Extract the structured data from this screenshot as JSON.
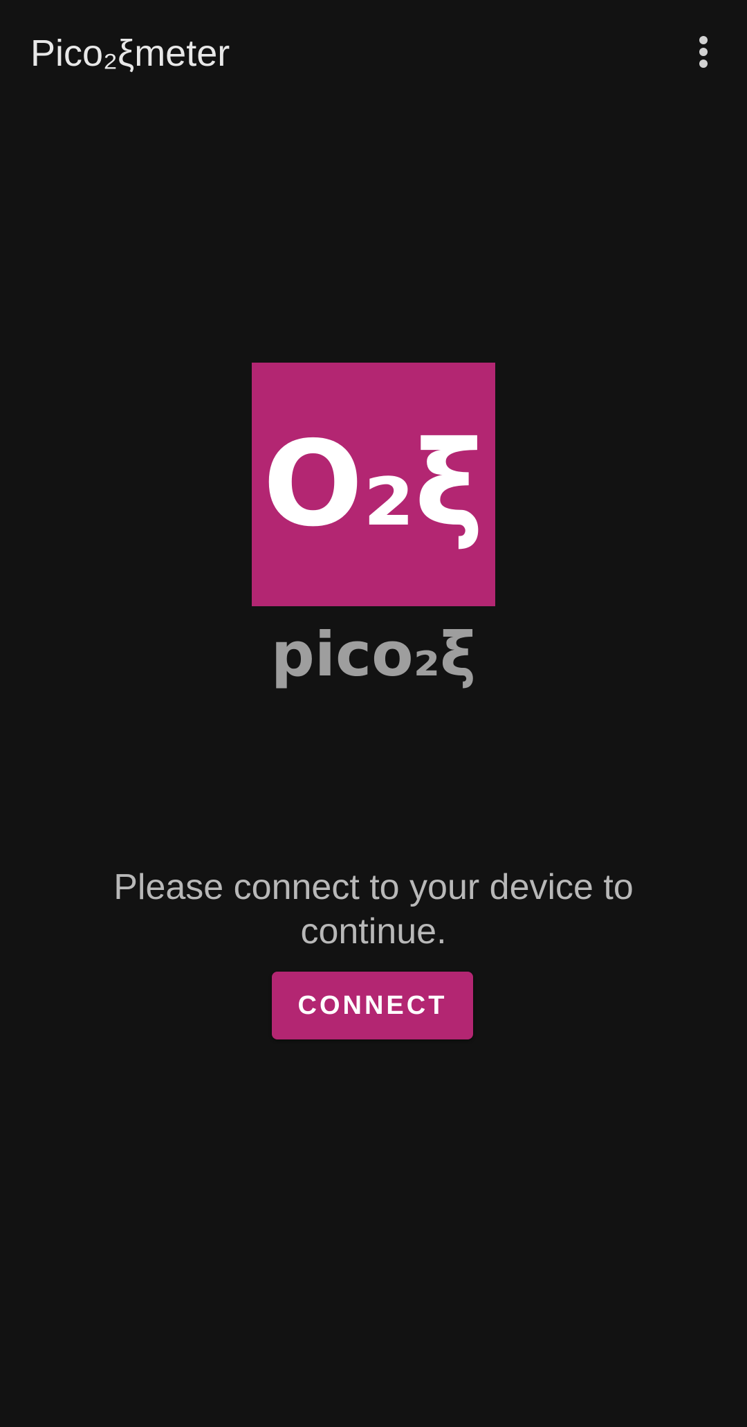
{
  "app_bar": {
    "title": "Pico₂ξmeter",
    "menu_icon": "more-vert-icon"
  },
  "logo": {
    "tile_text": "O₂ξ",
    "tile_color": "#b32672",
    "brand_name": "pico₂ξ"
  },
  "main": {
    "prompt": "Please connect to your device to continue.",
    "connect_label": "CONNECT"
  },
  "colors": {
    "background": "#121212",
    "accent": "#b32672"
  }
}
